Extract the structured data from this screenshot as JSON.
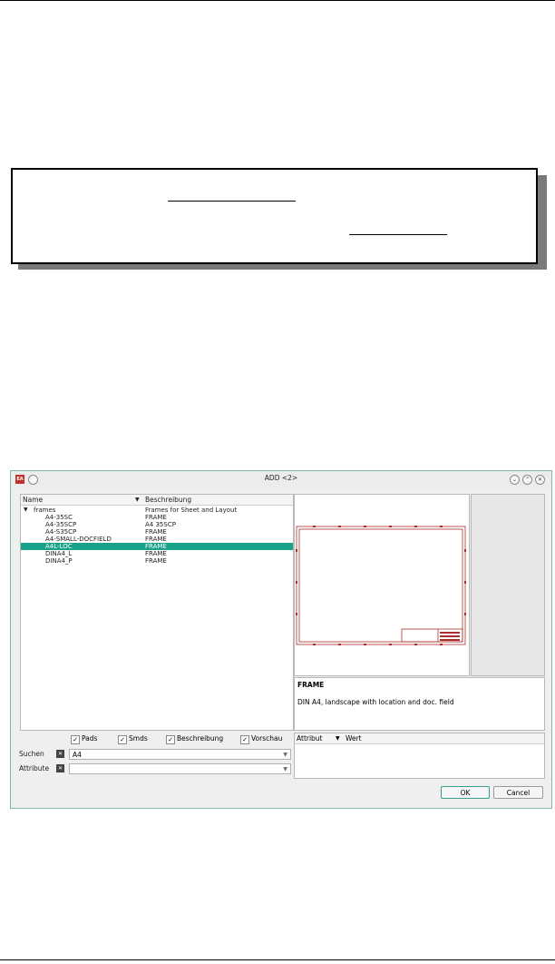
{
  "dialog": {
    "title": "ADD <2>",
    "app_icon_text": "EA",
    "window_buttons": [
      "minimize-icon",
      "maximize-icon",
      "close-icon"
    ],
    "tree_headers": {
      "name": "Name",
      "description": "Beschreibung"
    },
    "tree_rows": [
      {
        "name": "frames",
        "description": "Frames for Sheet and Layout"
      },
      {
        "name": "A4-35SC",
        "description": "FRAME"
      },
      {
        "name": "A4-35SCP",
        "description": "A4 35SCP"
      },
      {
        "name": "A4-S35CP",
        "description": "FRAME"
      },
      {
        "name": "A4-SMALL-DOCFIELD",
        "description": "FRAME"
      },
      {
        "name": "A4L-LOC",
        "description": "FRAME"
      },
      {
        "name": "DINA4_L",
        "description": "FRAME"
      },
      {
        "name": "DINA4_P",
        "description": "FRAME"
      }
    ],
    "selected_row": 5,
    "description_panel": {
      "title": "FRAME",
      "text": "DIN A4, landscape with location and doc. field"
    },
    "checkboxes": {
      "pads": "Pads",
      "smds": "Smds",
      "description": "Beschreibung",
      "preview": "Vorschau"
    },
    "search": {
      "label": "Suchen",
      "value": "A4"
    },
    "attribute": {
      "label": "Attribute",
      "value": ""
    },
    "attr_table_headers": {
      "attribute": "Attribut",
      "value": "Wert"
    },
    "buttons": {
      "ok": "OK",
      "cancel": "Cancel"
    },
    "colors": {
      "selection": "#1aa18a",
      "frame_line": "#a8302c"
    }
  }
}
